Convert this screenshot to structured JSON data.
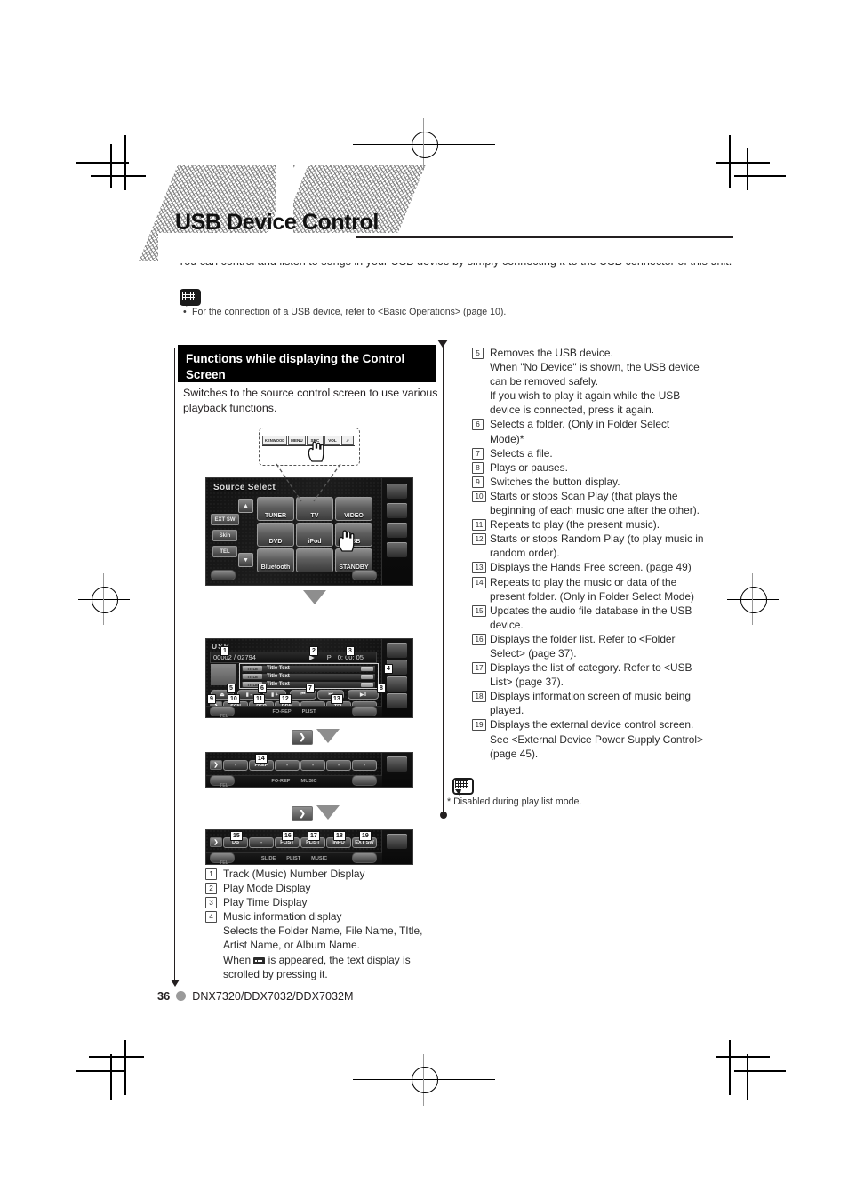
{
  "page": {
    "title": "USB Device Control",
    "intro": "You can control and listen to songs in your USB device by simply connecting it to the USB connector of this unit.",
    "intro_note": "For the connection of a USB device, refer to <Basic Operations> (page 10).",
    "footer_page": "36",
    "footer_models": "DNX7320/DDX7032/DDX7032M",
    "footnote": "*  Disabled during play list mode."
  },
  "section": {
    "header": "Functions while displaying the Control Screen",
    "description": "Switches to the source control screen to use various playback functions."
  },
  "source_select_screen": {
    "title": "Source Select",
    "side_buttons": [
      "EXT SW",
      "Skin",
      "TEL"
    ],
    "tiles": [
      "TUNER",
      "TV",
      "VIDEO",
      "DVD",
      "iPod",
      "USB",
      "Bluetooth",
      "",
      "STANDBY"
    ],
    "up_arrow": "▲",
    "down_arrow": "▼"
  },
  "balloon": {
    "brand": "KENWOOD",
    "cells": [
      "MENU",
      "SRC",
      "VOL",
      "↗"
    ]
  },
  "playback_screen": {
    "source_label": "USB",
    "track_number": "00002 / 02794",
    "play_icon": "▶",
    "play_mode": "P",
    "play_time": "0: 00: 05",
    "title_rows": [
      {
        "tag": "TITLE",
        "text": "Title Text"
      },
      {
        "tag": "TITLE",
        "text": "Title Text"
      },
      {
        "tag": "TITLE",
        "text": "Title Text"
      }
    ],
    "transport": {
      "eject": "⏏",
      "folder_down": "▮ -",
      "folder_up": "▮ +",
      "prev": "⏮",
      "next": "⏭",
      "play_pause": "▶‖"
    },
    "row1_buttons": [
      "SCN",
      "REP",
      "RDM",
      "-",
      "TEL",
      "-"
    ],
    "row1_status": [
      "FO-REP",
      "PLIST"
    ],
    "row2_buttons": [
      "-",
      "FREP",
      "-",
      "-",
      "-",
      "-"
    ],
    "row2_status": [
      "FO-REP",
      "MUSIC"
    ],
    "row3_buttons": [
      "DB",
      "-",
      "FLIST",
      "PLIST",
      "INFO",
      "EXT SW"
    ],
    "row3_status": [
      "SLIDE",
      "PLIST",
      "MUSIC"
    ],
    "next_button": "❯",
    "tel_label": "TEL"
  },
  "left_items": [
    {
      "n": "1",
      "lines": [
        "Track (Music) Number Display"
      ]
    },
    {
      "n": "2",
      "lines": [
        "Play Mode Display"
      ]
    },
    {
      "n": "3",
      "lines": [
        "Play Time Display"
      ]
    },
    {
      "n": "4",
      "lines": [
        "Music information display",
        "Selects the Folder Name, File Name, TItle, Artist Name, or Album Name.",
        "SCROLL_LINE"
      ],
      "scroll_prefix": "When ",
      "scroll_suffix": " is appeared, the text display is scrolled by pressing it."
    }
  ],
  "right_items": [
    {
      "n": "5",
      "text": "Removes the USB device.\nWhen \"No Device\" is shown, the USB device can be removed safely.\nIf you wish to play it again while the USB device is connected, press it again."
    },
    {
      "n": "6",
      "text": "Selects a folder. (Only in Folder Select Mode)*"
    },
    {
      "n": "7",
      "text": "Selects a file."
    },
    {
      "n": "8",
      "text": "Plays or pauses."
    },
    {
      "n": "9",
      "text": "Switches the button display."
    },
    {
      "n": "10",
      "text": "Starts or stops Scan Play (that plays the beginning of each music one after the other)."
    },
    {
      "n": "11",
      "text": "Repeats to play (the present music)."
    },
    {
      "n": "12",
      "text": "Starts or stops Random Play (to play music in random order)."
    },
    {
      "n": "13",
      "text": "Displays the Hands Free screen. (page 49)"
    },
    {
      "n": "14",
      "text": "Repeats to play the music or data of the present folder. (Only in Folder Select Mode)"
    },
    {
      "n": "15",
      "text": "Updates the audio file database in the USB device."
    },
    {
      "n": "16",
      "text": "Displays the folder list. Refer to <Folder Select> (page 37)."
    },
    {
      "n": "17",
      "text": "Displays the list of category. Refer to <USB List> (page 37)."
    },
    {
      "n": "18",
      "text": "Displays information screen of music being played."
    },
    {
      "n": "19",
      "text": "Displays the external device control screen. See <External Device Power Supply Control> (page 45)."
    }
  ],
  "panel_callouts": {
    "play": [
      "1",
      "2",
      "3",
      "4",
      "5",
      "6",
      "7",
      "8",
      "9",
      "10",
      "11",
      "12",
      "13"
    ],
    "sub1": [
      "14"
    ],
    "sub2": [
      "15",
      "16",
      "17",
      "18",
      "19"
    ]
  },
  "colors": {
    "header_bg": "#000000",
    "text": "#231f20",
    "panel_bg": "#0b0b0b",
    "footer_dot": "#9a9a9a"
  }
}
